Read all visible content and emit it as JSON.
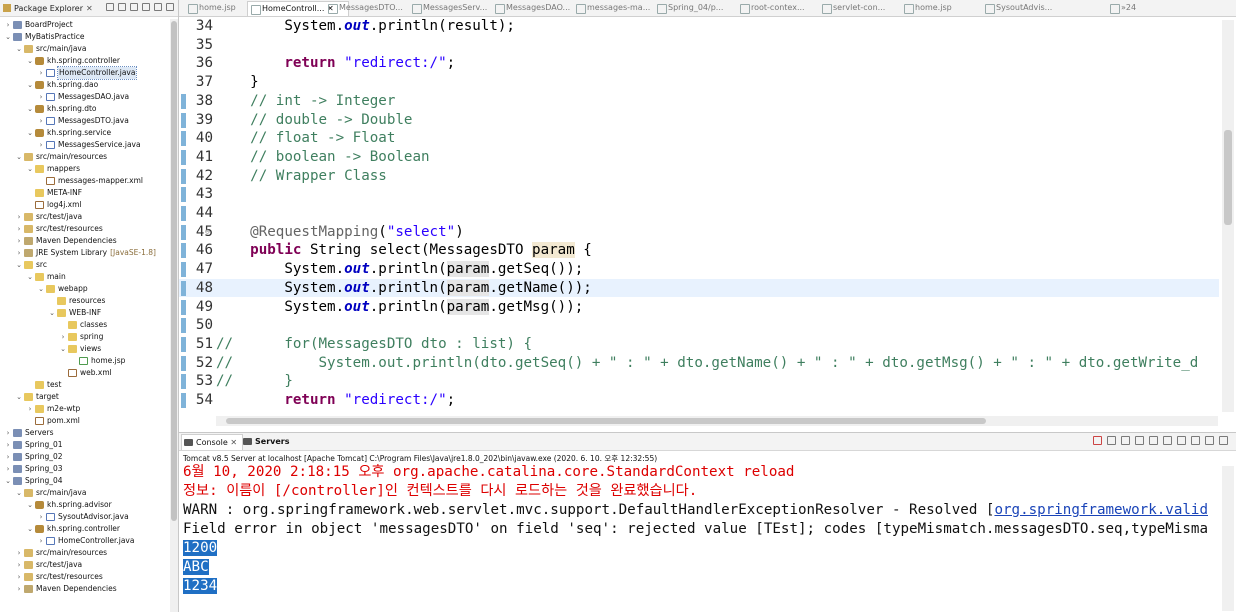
{
  "package_explorer": {
    "title": "Package Explorer",
    "tree": [
      {
        "depth": 0,
        "arrow": ">",
        "icon": "proj",
        "label": "BoardProject"
      },
      {
        "depth": 0,
        "arrow": "v",
        "icon": "proj",
        "label": "MyBatisPractice"
      },
      {
        "depth": 1,
        "arrow": "v",
        "icon": "pkgf",
        "label": "src/main/java"
      },
      {
        "depth": 2,
        "arrow": "v",
        "icon": "pkg",
        "label": "kh.spring.controller"
      },
      {
        "depth": 3,
        "arrow": ">",
        "icon": "java",
        "label": "HomeController.java",
        "selected": true
      },
      {
        "depth": 2,
        "arrow": "v",
        "icon": "pkg",
        "label": "kh.spring.dao"
      },
      {
        "depth": 3,
        "arrow": ">",
        "icon": "java",
        "label": "MessagesDAO.java"
      },
      {
        "depth": 2,
        "arrow": "v",
        "icon": "pkg",
        "label": "kh.spring.dto"
      },
      {
        "depth": 3,
        "arrow": ">",
        "icon": "java",
        "label": "MessagesDTO.java"
      },
      {
        "depth": 2,
        "arrow": "v",
        "icon": "pkg",
        "label": "kh.spring.service"
      },
      {
        "depth": 3,
        "arrow": ">",
        "icon": "java",
        "label": "MessagesService.java"
      },
      {
        "depth": 1,
        "arrow": "v",
        "icon": "pkgf",
        "label": "src/main/resources"
      },
      {
        "depth": 2,
        "arrow": "v",
        "icon": "folder",
        "label": "mappers"
      },
      {
        "depth": 3,
        "arrow": "",
        "icon": "xml",
        "label": "messages-mapper.xml"
      },
      {
        "depth": 2,
        "arrow": "",
        "icon": "folder",
        "label": "META-INF"
      },
      {
        "depth": 2,
        "arrow": "",
        "icon": "xml",
        "label": "log4j.xml"
      },
      {
        "depth": 1,
        "arrow": ">",
        "icon": "pkgf",
        "label": "src/test/java"
      },
      {
        "depth": 1,
        "arrow": ">",
        "icon": "pkgf",
        "label": "src/test/resources"
      },
      {
        "depth": 1,
        "arrow": ">",
        "icon": "lib",
        "label": "Maven Dependencies"
      },
      {
        "depth": 1,
        "arrow": ">",
        "icon": "lib",
        "label": "JRE System Library",
        "deco": "[JavaSE-1.8]"
      },
      {
        "depth": 1,
        "arrow": "v",
        "icon": "folder",
        "label": "src"
      },
      {
        "depth": 2,
        "arrow": "v",
        "icon": "folder",
        "label": "main"
      },
      {
        "depth": 3,
        "arrow": "v",
        "icon": "folder",
        "label": "webapp"
      },
      {
        "depth": 4,
        "arrow": "",
        "icon": "folder",
        "label": "resources"
      },
      {
        "depth": 4,
        "arrow": "v",
        "icon": "folder",
        "label": "WEB-INF"
      },
      {
        "depth": 5,
        "arrow": "",
        "icon": "folder",
        "label": "classes"
      },
      {
        "depth": 5,
        "arrow": ">",
        "icon": "folder",
        "label": "spring"
      },
      {
        "depth": 5,
        "arrow": "v",
        "icon": "folder",
        "label": "views"
      },
      {
        "depth": 6,
        "arrow": "",
        "icon": "jsp",
        "label": "home.jsp"
      },
      {
        "depth": 5,
        "arrow": "",
        "icon": "xml",
        "label": "web.xml"
      },
      {
        "depth": 2,
        "arrow": "",
        "icon": "folder",
        "label": "test"
      },
      {
        "depth": 1,
        "arrow": "v",
        "icon": "folder",
        "label": "target"
      },
      {
        "depth": 2,
        "arrow": ">",
        "icon": "folder",
        "label": "m2e-wtp"
      },
      {
        "depth": 2,
        "arrow": "",
        "icon": "xml",
        "label": "pom.xml"
      },
      {
        "depth": 0,
        "arrow": ">",
        "icon": "proj",
        "label": "Servers"
      },
      {
        "depth": 0,
        "arrow": ">",
        "icon": "proj",
        "label": "Spring_01"
      },
      {
        "depth": 0,
        "arrow": ">",
        "icon": "proj",
        "label": "Spring_02"
      },
      {
        "depth": 0,
        "arrow": ">",
        "icon": "proj",
        "label": "Spring_03"
      },
      {
        "depth": 0,
        "arrow": "v",
        "icon": "proj",
        "label": "Spring_04"
      },
      {
        "depth": 1,
        "arrow": "v",
        "icon": "pkgf",
        "label": "src/main/java"
      },
      {
        "depth": 2,
        "arrow": "v",
        "icon": "pkg",
        "label": "kh.spring.advisor"
      },
      {
        "depth": 3,
        "arrow": ">",
        "icon": "java",
        "label": "SysoutAdvisor.java"
      },
      {
        "depth": 2,
        "arrow": "v",
        "icon": "pkg",
        "label": "kh.spring.controller"
      },
      {
        "depth": 3,
        "arrow": ">",
        "icon": "java",
        "label": "HomeController.java"
      },
      {
        "depth": 1,
        "arrow": ">",
        "icon": "pkgf",
        "label": "src/main/resources"
      },
      {
        "depth": 1,
        "arrow": ">",
        "icon": "pkgf",
        "label": "src/test/java"
      },
      {
        "depth": 1,
        "arrow": ">",
        "icon": "pkgf",
        "label": "src/test/resources"
      },
      {
        "depth": 1,
        "arrow": ">",
        "icon": "lib",
        "label": "Maven Dependencies"
      }
    ]
  },
  "editor": {
    "tabs": [
      "home.jsp",
      "HomeControll...",
      "MessagesDTO...",
      "MessagesServ...",
      "MessagesDAO...",
      "messages-ma...",
      "Spring_04/p...",
      "root-contex...",
      "servlet-con...",
      "home.jsp",
      "SysoutAdvis..."
    ],
    "active_tab": 1,
    "overflow_label": "»24",
    "current_line": 48,
    "lines": [
      {
        "n": "34",
        "segs": [
          [
            "",
            "        System."
          ],
          [
            "fld",
            "out"
          ],
          [
            "",
            ".println(result);"
          ]
        ]
      },
      {
        "n": "35",
        "segs": []
      },
      {
        "n": "36",
        "segs": [
          [
            "",
            "        "
          ],
          [
            "kw",
            "return"
          ],
          [
            "",
            " "
          ],
          [
            "str",
            "\"redirect:/\""
          ],
          [
            "",
            ";"
          ]
        ]
      },
      {
        "n": "37",
        "segs": [
          [
            "",
            "    }"
          ]
        ]
      },
      {
        "n": "38",
        "mark": true,
        "segs": [
          [
            "cm",
            "    // int -> Integer"
          ]
        ]
      },
      {
        "n": "39",
        "mark": true,
        "segs": [
          [
            "cm",
            "    // double -> Double"
          ]
        ]
      },
      {
        "n": "40",
        "mark": true,
        "segs": [
          [
            "cm",
            "    // float -> Float"
          ]
        ]
      },
      {
        "n": "41",
        "mark": true,
        "segs": [
          [
            "cm",
            "    // boolean -> Boolean"
          ]
        ]
      },
      {
        "n": "42",
        "mark": true,
        "segs": [
          [
            "cm",
            "    // Wrapper Class"
          ]
        ]
      },
      {
        "n": "43",
        "mark": true,
        "segs": []
      },
      {
        "n": "44",
        "mark": true,
        "segs": []
      },
      {
        "n": "45",
        "mark": true,
        "fold": true,
        "segs": [
          [
            "",
            "    "
          ],
          [
            "ann",
            "@RequestMapping"
          ],
          [
            "",
            "("
          ],
          [
            "str",
            "\"select\""
          ],
          [
            "",
            ")"
          ]
        ]
      },
      {
        "n": "46",
        "mark": true,
        "segs": [
          [
            "",
            "    "
          ],
          [
            "kw",
            "public"
          ],
          [
            "",
            " String select(MessagesDTO "
          ],
          [
            "prm",
            "param"
          ],
          [
            "",
            " {"
          ]
        ]
      },
      {
        "n": "47",
        "mark": true,
        "segs": [
          [
            "",
            "        System."
          ],
          [
            "fld",
            "out"
          ],
          [
            "",
            ".println("
          ],
          [
            "prmh",
            "param"
          ],
          [
            "",
            ".getSeq());"
          ]
        ]
      },
      {
        "n": "48",
        "mark": true,
        "segs": [
          [
            "",
            "        System."
          ],
          [
            "fld",
            "out"
          ],
          [
            "",
            ".println("
          ],
          [
            "prmh",
            "param"
          ],
          [
            "",
            ".getName());"
          ]
        ]
      },
      {
        "n": "49",
        "mark": true,
        "segs": [
          [
            "",
            "        System."
          ],
          [
            "fld",
            "out"
          ],
          [
            "",
            ".println("
          ],
          [
            "prmh",
            "param"
          ],
          [
            "",
            ".getMsg());"
          ]
        ]
      },
      {
        "n": "50",
        "mark": true,
        "segs": []
      },
      {
        "n": "51",
        "mark": true,
        "segs": [
          [
            "cm",
            "//      for(MessagesDTO dto : list) {"
          ]
        ]
      },
      {
        "n": "52",
        "mark": true,
        "segs": [
          [
            "cm",
            "//          System.out.println(dto.getSeq() + \" : \" + dto.getName() + \" : \" + dto.getMsg() + \" : \" + dto.getWrite_d"
          ]
        ]
      },
      {
        "n": "53",
        "mark": true,
        "segs": [
          [
            "cm",
            "//      }"
          ]
        ]
      },
      {
        "n": "54",
        "mark": true,
        "segs": [
          [
            "",
            "        "
          ],
          [
            "kw",
            "return"
          ],
          [
            "",
            " "
          ],
          [
            "str",
            "\"redirect:/\""
          ],
          [
            "",
            ";"
          ]
        ]
      }
    ]
  },
  "console": {
    "tabs": [
      "Console",
      "Servers"
    ],
    "active_tab": 0,
    "description": "Tomcat v8.5 Server at localhost [Apache Tomcat] C:\\Program Files\\Java\\jre1.8.0_202\\bin\\javaw.exe (2020. 6. 10. 오후 12:32:55)",
    "lines": [
      {
        "color": "red",
        "text": "6월 10, 2020 2:18:15 오후 org.apache.catalina.core.StandardContext reload"
      },
      {
        "color": "red",
        "text": "정보: 이름이 [/controller]인 컨텍스트를 다시 로드하는 것을 완료했습니다."
      },
      {
        "color": "blk",
        "text": "WARN : org.springframework.web.servlet.mvc.support.DefaultHandlerExceptionResolver - Resolved [",
        "link": "org.springframework.valid"
      },
      {
        "color": "blk",
        "text": "Field error in object 'messagesDTO' on field 'seq': rejected value [TEst]; codes [typeMismatch.messagesDTO.seq,typeMisma"
      },
      {
        "color": "sel",
        "text": "1200"
      },
      {
        "color": "sel",
        "text": "ABC"
      },
      {
        "color": "sel",
        "text": "1234"
      }
    ]
  }
}
